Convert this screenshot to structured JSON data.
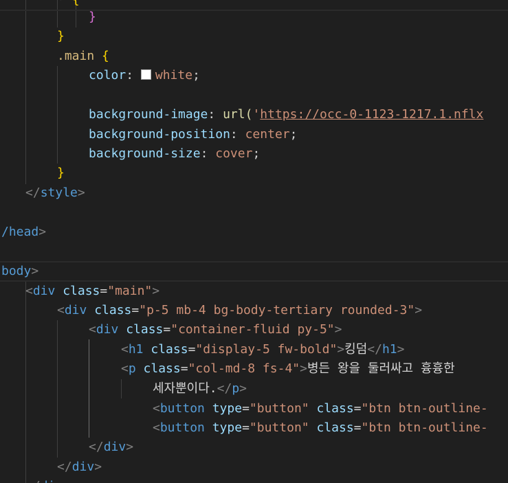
{
  "editor": {
    "css": {
      "brace_open_fragment": "{",
      "brace_close_inner": "}",
      "brace_close_outer": "}",
      "selector": ".main",
      "color_prop": "color",
      "color_value": "white",
      "bgimage_prop": "background-image",
      "bgimage_fn": "url(",
      "bgimage_quote": "'",
      "bgimage_url": "https://occ-0-1123-1217.1.nflx",
      "bgpos_prop": "background-position",
      "bgpos_value": "center",
      "bgsize_prop": "background-size",
      "bgsize_value": "cover",
      "main_close": "}",
      "style_close": "style"
    },
    "head_close": "head",
    "body_open": "body",
    "html": {
      "div1_tag": "div",
      "div1_attr": "class",
      "div1_value": "\"main\"",
      "div2_tag": "div",
      "div2_attr": "class",
      "div2_value": "\"p-5 mb-4 bg-body-tertiary rounded-3\"",
      "div3_tag": "div",
      "div3_attr": "class",
      "div3_value": "\"container-fluid py-5\"",
      "h1_tag": "h1",
      "h1_attr": "class",
      "h1_value": "\"display-5 fw-bold\"",
      "h1_text": "킹덤",
      "p_tag": "p",
      "p_attr": "class",
      "p_value": "\"col-md-8 fs-4\"",
      "p_text_1": "병든 왕을 둘러싸고 흉흉한",
      "p_text_2": "세자뿐이다.",
      "btn1_tag": "button",
      "btn1_attr1": "type",
      "btn1_val1": "\"button\"",
      "btn1_attr2": "class",
      "btn1_val2": "\"btn btn-outline-",
      "btn2_tag": "button",
      "btn2_attr1": "type",
      "btn2_val1": "\"button\"",
      "btn2_attr2": "class",
      "btn2_val2": "\"btn btn-outline-",
      "div3_close": "div",
      "div2_close": "div"
    },
    "colors": {
      "background": "#1f1f1f",
      "tag": "#569cd6",
      "attribute": "#9cdcfe",
      "string": "#ce9178",
      "selector": "#d7ba7d",
      "bracket_gold": "#ffd700",
      "bracket_purple": "#da70d6"
    }
  }
}
